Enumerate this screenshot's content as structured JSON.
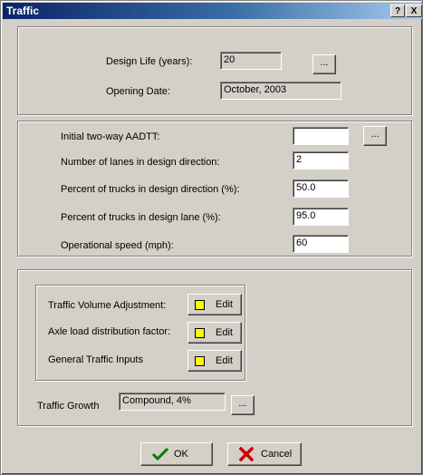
{
  "window": {
    "title": "Traffic",
    "help_label": "?",
    "close_label": "X"
  },
  "design": {
    "design_life_label": "Design Life (years):",
    "design_life_value": "20",
    "opening_date_label": "Opening Date:",
    "opening_date_value": "October, 2003",
    "browse_label": "..."
  },
  "volume": {
    "aadtt_label": "Initial two-way AADTT:",
    "aadtt_value": "",
    "lanes_label": "Number of lanes in design direction:",
    "lanes_value": "2",
    "pct_dir_label": "Percent of trucks in design direction (%):",
    "pct_dir_value": "50.0",
    "pct_lane_label": "Percent of trucks in design lane (%):",
    "pct_lane_value": "95.0",
    "speed_label": "Operational speed (mph):",
    "speed_value": "60",
    "browse_label": "..."
  },
  "adjustments": {
    "items": [
      {
        "label": "Traffic Volume Adjustment:",
        "button": "Edit"
      },
      {
        "label": "Axle load distribution factor:",
        "button": "Edit"
      },
      {
        "label": "General Traffic Inputs",
        "button": "Edit"
      }
    ],
    "growth_label": "Traffic Growth",
    "growth_value": "Compound, 4%",
    "browse_label": "...",
    "indicator_color": "#ffff00"
  },
  "footer": {
    "ok_label": "OK",
    "cancel_label": "Cancel",
    "ok_color": "#008000",
    "cancel_color": "#cc0000"
  }
}
